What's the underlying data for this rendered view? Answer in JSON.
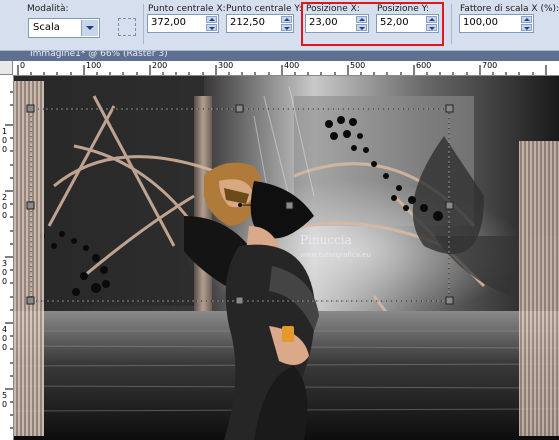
{
  "toolbar": {
    "mode": {
      "label": "Modalità:",
      "value": "Scala"
    },
    "center_x": {
      "label": "Punto centrale X:",
      "value": "372,00"
    },
    "center_y": {
      "label": "Punto centrale Y:",
      "value": "212,50"
    },
    "pos_x": {
      "label": "Posizione X:",
      "value": "23,00"
    },
    "pos_y": {
      "label": "Posizione Y:",
      "value": "52,00"
    },
    "scale_x": {
      "label": "Fattore di scala X (%):",
      "value": "100,00"
    }
  },
  "document_title": "Immagine1* @ 66% (Raster 3)",
  "ruler": {
    "horizontal_ticks": [
      "0",
      "100",
      "200",
      "300",
      "400",
      "500",
      "600",
      "700"
    ],
    "vertical_ticks": [
      "1",
      "0",
      "0",
      "2",
      "0",
      "0",
      "3",
      "0",
      "0",
      "4",
      "0",
      "0",
      "5",
      "0"
    ]
  },
  "watermark": {
    "line1": "Pinuccia",
    "line2": "www.tutorgrafica.eu"
  },
  "colors": {
    "toolbar_bg": "#d6dfee",
    "highlight": "#e0161b",
    "title_bar": "#5f6f92"
  },
  "icons": [
    "chevron-down-icon",
    "spin-up-icon",
    "spin-down-icon",
    "pick-tool-icon"
  ]
}
